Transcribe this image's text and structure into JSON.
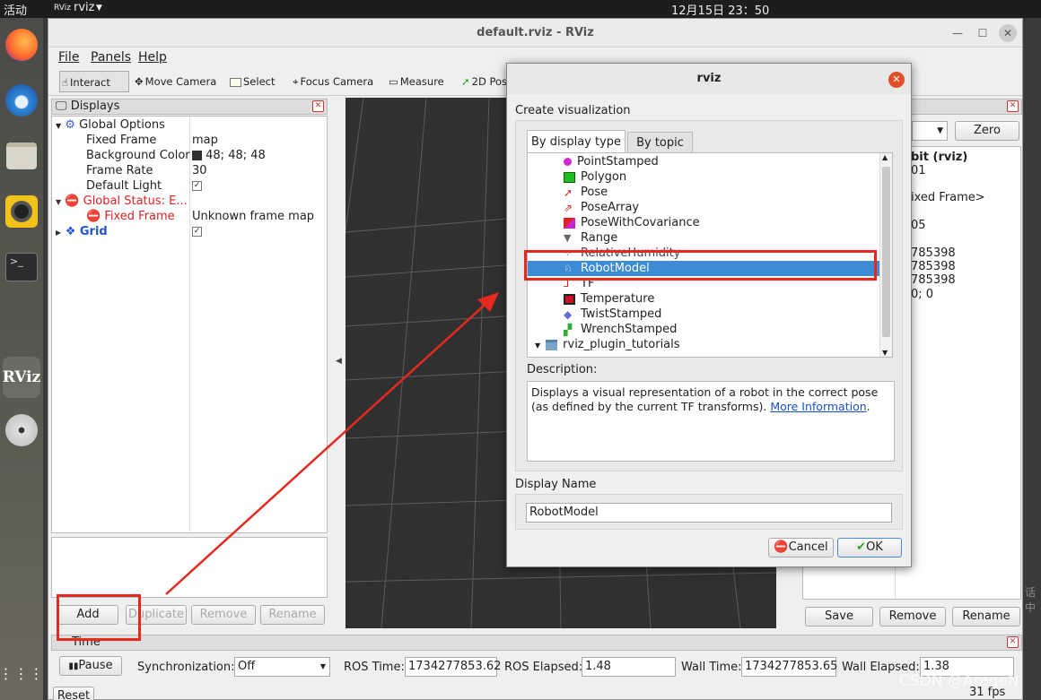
{
  "topbar": {
    "activities": "活动",
    "app": "rviz",
    "clock": "12月15日  23：50"
  },
  "window": {
    "title": "default.rviz - RViz"
  },
  "menu": [
    "File",
    "Panels",
    "Help"
  ],
  "toolbar": [
    "Interact",
    "Move Camera",
    "Select",
    "Focus Camera",
    "Measure",
    "2D Pose"
  ],
  "displays": {
    "title": "Displays",
    "rows": [
      {
        "name": "Global Options",
        "value": ""
      },
      {
        "name": "Fixed Frame",
        "value": "map"
      },
      {
        "name": "Background Color",
        "value": "48; 48; 48"
      },
      {
        "name": "Frame Rate",
        "value": "30"
      },
      {
        "name": "Default Light",
        "value": "✓"
      },
      {
        "name": "Global Status: E...",
        "value": ""
      },
      {
        "name": "Fixed Frame",
        "value": "Unknown frame map"
      },
      {
        "name": "Grid",
        "value": "✓"
      }
    ],
    "buttons": [
      "Add",
      "Duplicate",
      "Remove",
      "Rename"
    ]
  },
  "views": {
    "zero": "Zero",
    "lines": [
      "bit (rviz)",
      "01",
      "",
      "ixed Frame>",
      "",
      "05",
      "",
      "785398",
      "785398",
      "785398",
      "0; 0"
    ],
    "buttons": [
      "Save",
      "Remove",
      "Rename"
    ]
  },
  "time": {
    "title": "Time",
    "pause": "Pause",
    "sync_label": "Synchronization:",
    "sync_value": "Off",
    "ros_time_label": "ROS Time:",
    "ros_time": "1734277853.62",
    "ros_elapsed_label": "ROS Elapsed:",
    "ros_elapsed": "1.48",
    "wall_time_label": "Wall Time:",
    "wall_time": "1734277853.65",
    "wall_elapsed_label": "Wall Elapsed:",
    "wall_elapsed": "1.38",
    "reset": "Reset",
    "fps": "31 fps"
  },
  "dialog": {
    "title": "rviz",
    "heading": "Create visualization",
    "tabs": [
      "By display type",
      "By topic"
    ],
    "items": [
      "PointStamped",
      "Polygon",
      "Pose",
      "PoseArray",
      "PoseWithCovariance",
      "Range",
      "RelativeHumidity",
      "RobotModel",
      "TF",
      "Temperature",
      "TwistStamped",
      "WrenchStamped",
      "rviz_plugin_tutorials"
    ],
    "selected": "RobotModel",
    "description_label": "Description:",
    "description_text": "Displays a visual representation of a robot in the correct pose (as defined by the current TF transforms). ",
    "description_link": "More Information",
    "name_label": "Display Name",
    "name_value": "RobotModel",
    "cancel": "Cancel",
    "ok": "OK"
  },
  "watermark": "CSDN @AregeN",
  "side_chars": "话中"
}
